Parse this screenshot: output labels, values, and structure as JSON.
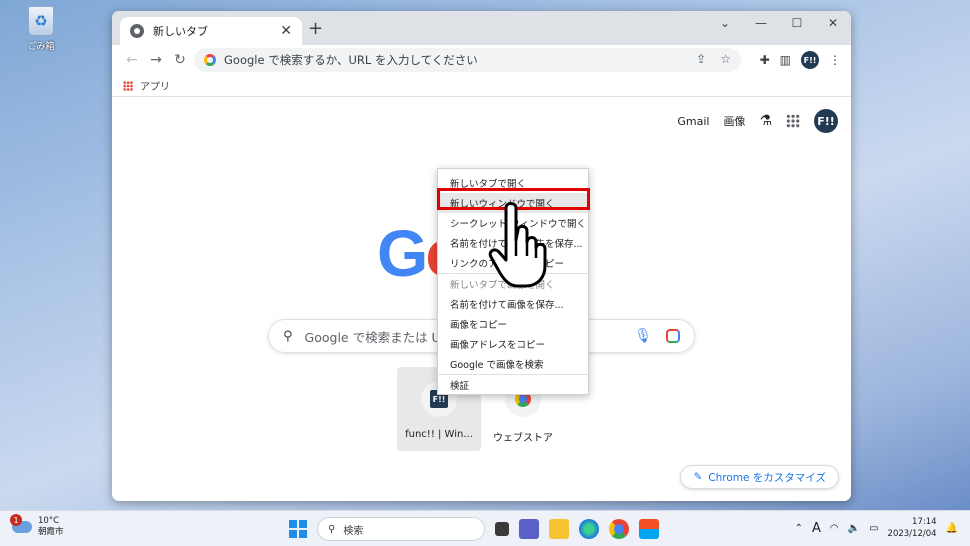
{
  "desktop": {
    "recycle_bin_label": "ごみ箱"
  },
  "browser": {
    "tab_title": "新しいタブ",
    "address_placeholder": "Google で検索するか、URL を入力してください",
    "profile_initials": "F!!",
    "bookmark_apps": "アプリ"
  },
  "ntp": {
    "links": {
      "gmail": "Gmail",
      "images": "画像"
    },
    "logo_letters": [
      "G",
      "o"
    ],
    "search_placeholder": "Google で検索または UI",
    "shortcuts": [
      {
        "label": "func!! | Win..."
      },
      {
        "label": "ウェブストア"
      }
    ],
    "customize_label": "Chrome をカスタマイズ"
  },
  "context_menu": {
    "items": [
      "新しいタブで開く",
      "新しいウィンドウで開く",
      "シークレット ウィンドウで開く",
      "名前を付けてリンク先を保存...",
      "リンクのアドレスをコピー",
      "新しいタブで画像を開く",
      "名前を付けて画像を保存...",
      "画像をコピー",
      "画像アドレスをコピー",
      "Google で画像を検索",
      "検証"
    ]
  },
  "taskbar": {
    "weather_temp": "10°C",
    "weather_place": "朝霞市",
    "weather_badge": "1",
    "search_label": "検索",
    "ime": "A",
    "time": "17:14",
    "date": "2023/12/04"
  },
  "colors": {
    "highlight_box": "#e00000",
    "accent": "#1a73e8",
    "avatar": "#233a55"
  }
}
